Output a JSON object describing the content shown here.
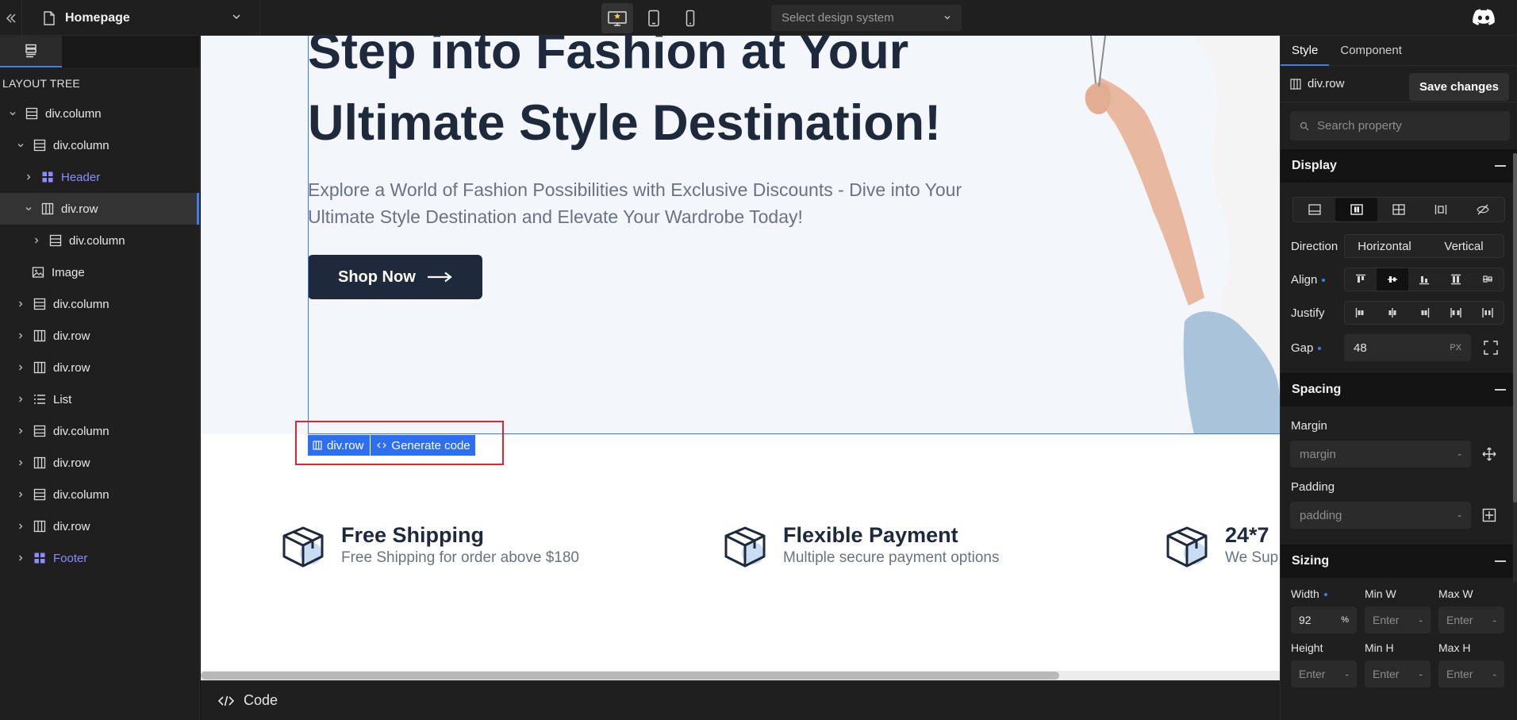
{
  "topbar": {
    "collapse_icon": "double-chevron-left-icon",
    "page_name": "Homepage",
    "design_system_placeholder": "Select design system"
  },
  "sidebar": {
    "tree_title": "LAYOUT TREE",
    "items": [
      {
        "label": "div.column",
        "icon": "column-icon"
      },
      {
        "label": "div.column",
        "icon": "column-icon"
      },
      {
        "label": "Header",
        "icon": "component-icon"
      },
      {
        "label": "div.row",
        "icon": "row-icon"
      },
      {
        "label": "div.column",
        "icon": "column-icon"
      },
      {
        "label": "Image",
        "icon": "image-icon"
      },
      {
        "label": "div.column",
        "icon": "column-icon"
      },
      {
        "label": "div.row",
        "icon": "row-icon"
      },
      {
        "label": "div.row",
        "icon": "row-icon"
      },
      {
        "label": "List",
        "icon": "list-icon"
      },
      {
        "label": "div.column",
        "icon": "column-icon"
      },
      {
        "label": "div.row",
        "icon": "row-icon"
      },
      {
        "label": "div.column",
        "icon": "column-icon"
      },
      {
        "label": "div.row",
        "icon": "row-icon"
      },
      {
        "label": "Footer",
        "icon": "component-icon"
      }
    ]
  },
  "canvas": {
    "hero_title": "Step into Fashion at Your Ultimate Style Destination!",
    "hero_subtitle": "Explore a World of Fashion Possibilities with Exclusive Discounts - Dive into Your Ultimate Style Destination and Elevate Your Wardrobe Today!",
    "shop_button": "Shop Now",
    "selection_tag": "div.row",
    "generate_code": "Generate code",
    "features": [
      {
        "title": "Free Shipping",
        "desc": "Free Shipping for order above $180"
      },
      {
        "title": "Flexible Payment",
        "desc": "Multiple secure payment options"
      },
      {
        "title": "24*7",
        "desc": "We Sup"
      }
    ]
  },
  "codebar": {
    "label": "Code"
  },
  "rpanel": {
    "tabs": [
      "Style",
      "Component"
    ],
    "selected_element": "div.row",
    "save_label": "Save changes",
    "search_placeholder": "Search property",
    "display": {
      "title": "Display",
      "direction_label": "Direction",
      "direction_options": [
        "Horizontal",
        "Vertical"
      ],
      "align_label": "Align",
      "justify_label": "Justify",
      "gap_label": "Gap",
      "gap_value": "48",
      "gap_unit": "PX"
    },
    "spacing": {
      "title": "Spacing",
      "margin_label": "Margin",
      "margin_placeholder": "margin",
      "padding_label": "Padding",
      "padding_placeholder": "padding",
      "dash": "-"
    },
    "sizing": {
      "title": "Sizing",
      "width_label": "Width",
      "width_value": "92",
      "width_unit": "%",
      "minw_label": "Min W",
      "maxw_label": "Max W",
      "height_label": "Height",
      "minh_label": "Min H",
      "maxh_label": "Max H",
      "enter": "Enter",
      "dash": "-"
    }
  },
  "colors": {
    "accent": "#3f7cf0",
    "selection_red": "#e0262e",
    "hero_bg": "#f3f6fa",
    "navy": "#1e2a3b"
  }
}
